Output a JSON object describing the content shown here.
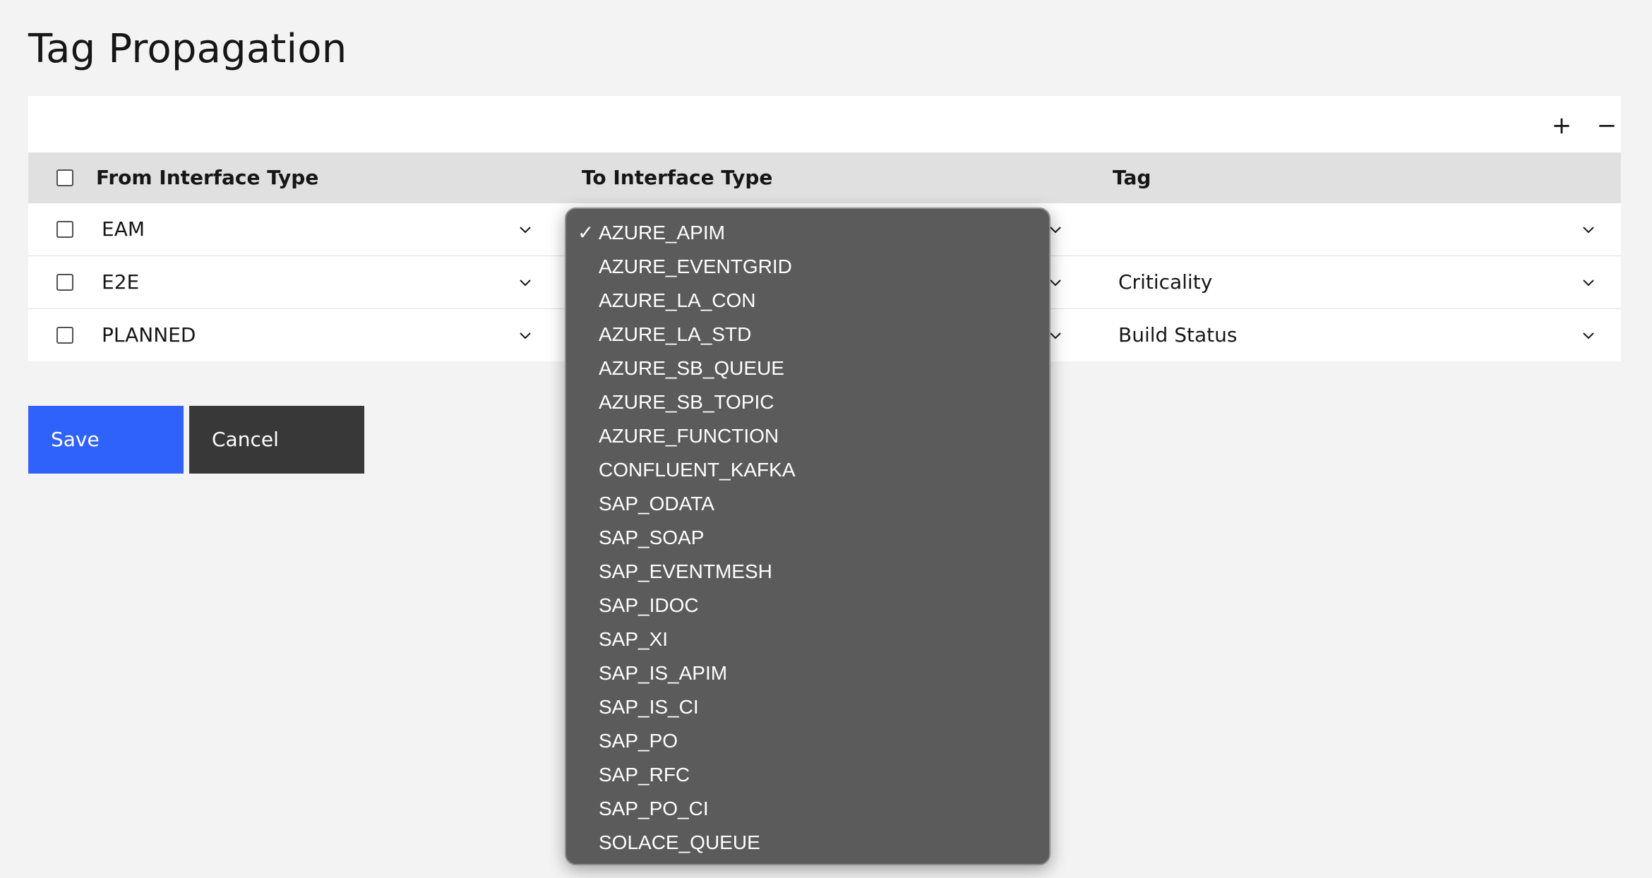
{
  "page": {
    "title": "Tag Propagation"
  },
  "toolbar": {
    "add_label": "+",
    "remove_label": "−"
  },
  "table": {
    "headers": {
      "from": "From Interface Type",
      "to": "To Interface Type",
      "tag": "Tag"
    },
    "rows": [
      {
        "from": "EAM",
        "to": "",
        "tag": ""
      },
      {
        "from": "E2E",
        "to": "",
        "tag": "Criticality"
      },
      {
        "from": "PLANNED",
        "to": "",
        "tag": "Build Status"
      }
    ]
  },
  "actions": {
    "save_label": "Save",
    "cancel_label": "Cancel"
  },
  "dropdown": {
    "check_mark": "✓",
    "selected_index": 0,
    "options": [
      "AZURE_APIM",
      "AZURE_EVENTGRID",
      "AZURE_LA_CON",
      "AZURE_LA_STD",
      "AZURE_SB_QUEUE",
      "AZURE_SB_TOPIC",
      "AZURE_FUNCTION",
      "CONFLUENT_KAFKA",
      "SAP_ODATA",
      "SAP_SOAP",
      "SAP_EVENTMESH",
      "SAP_IDOC",
      "SAP_XI",
      "SAP_IS_APIM",
      "SAP_IS_CI",
      "SAP_PO",
      "SAP_RFC",
      "SAP_PO_CI",
      "SOLACE_QUEUE"
    ]
  },
  "colors": {
    "page_background": "#f3f3f3",
    "save_button": "#2f62fa",
    "cancel_button": "#383838",
    "header_row": "#e0e0e0",
    "dropdown_background": "#5b5b5b"
  }
}
